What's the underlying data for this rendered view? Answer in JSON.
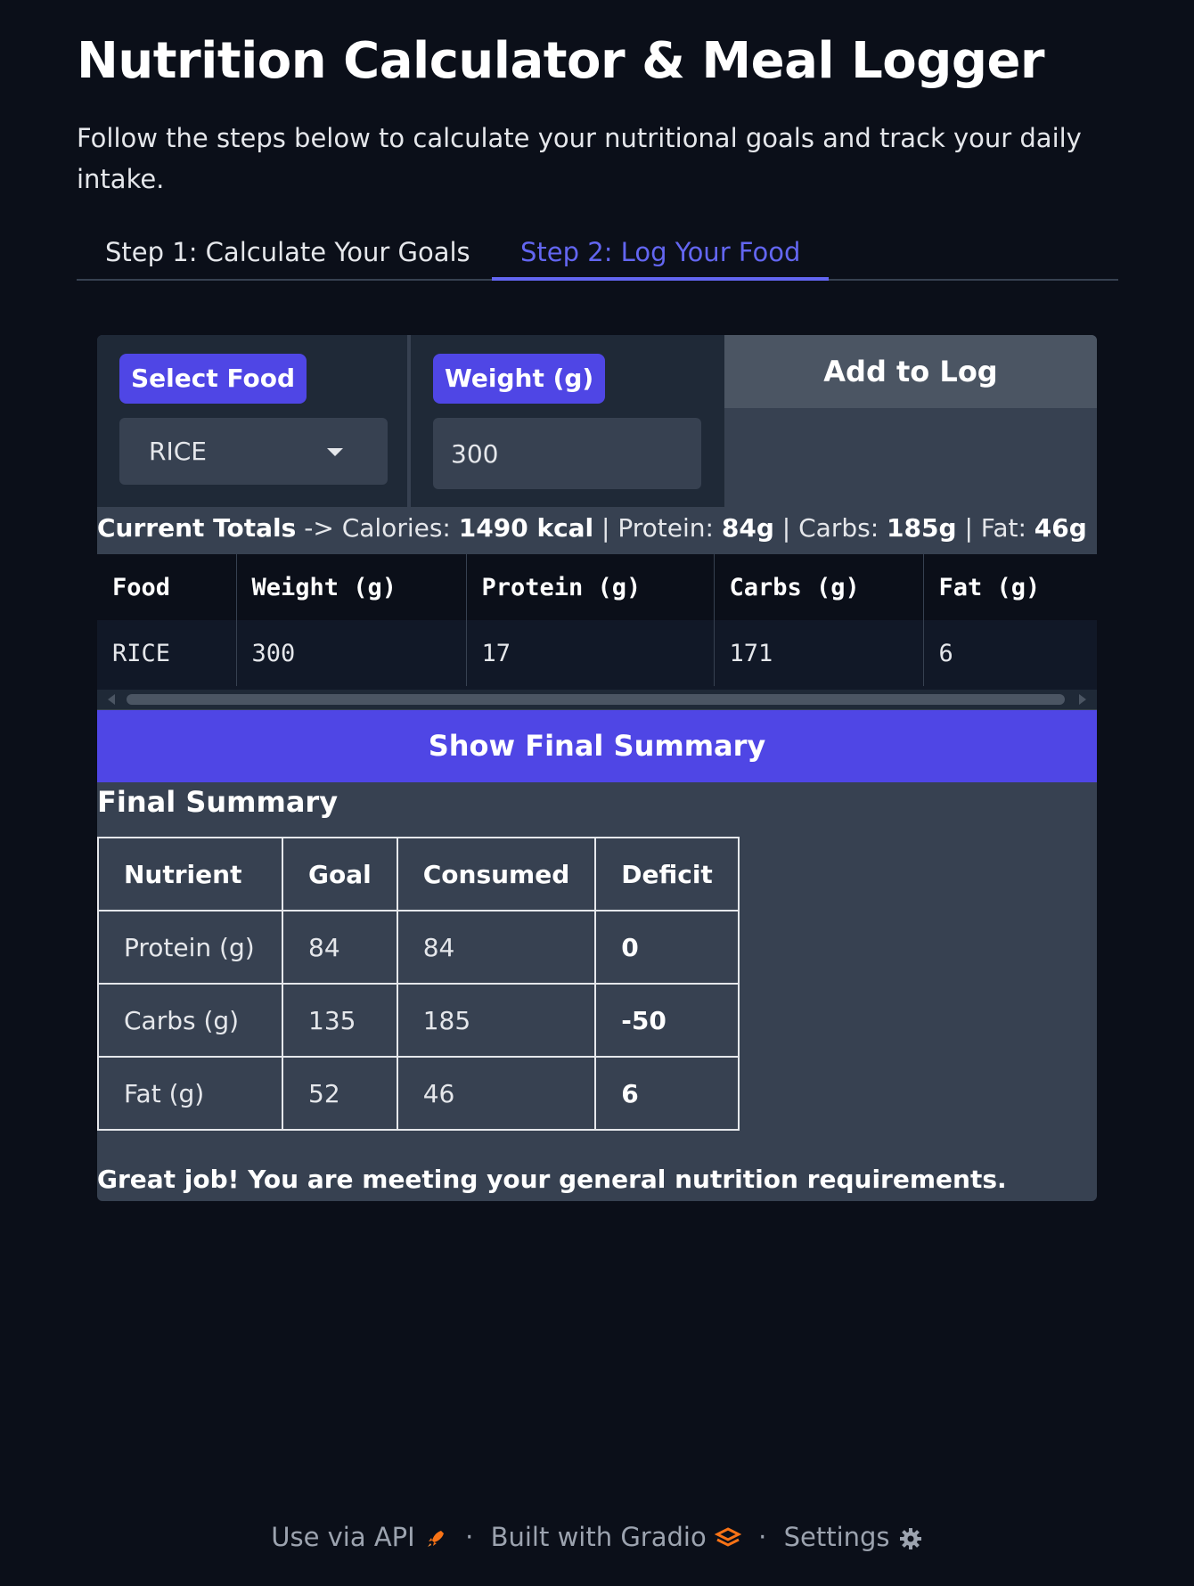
{
  "header": {
    "title": "Nutrition Calculator & Meal Logger",
    "subtitle": "Follow the steps below to calculate your nutritional goals and track your daily intake."
  },
  "tabs": [
    {
      "label": "Step 1: Calculate Your Goals",
      "active": false
    },
    {
      "label": "Step 2: Log Your Food",
      "active": true
    }
  ],
  "form": {
    "food_label": "Select Food",
    "food_value": "RICE",
    "weight_label": "Weight (g)",
    "weight_value": "300",
    "add_button": "Add to Log"
  },
  "totals": {
    "prefix": "Current Totals",
    "arrow": " -> Calories: ",
    "calories": "1490 kcal",
    "protein_label": " | Protein: ",
    "protein": "84g",
    "carbs_label": " | Carbs: ",
    "carbs": "185g",
    "fat_label": " | Fat: ",
    "fat": "46g"
  },
  "log_table": {
    "headers": [
      "Food",
      "Weight (g)",
      "Protein (g)",
      "Carbs (g)",
      "Fat (g)"
    ],
    "rows": [
      [
        "RICE",
        "300",
        "17",
        "171",
        "6"
      ]
    ]
  },
  "summary_button": "Show Final Summary",
  "final_summary": {
    "heading": "Final Summary",
    "headers": [
      "Nutrient",
      "Goal",
      "Consumed",
      "Deficit"
    ],
    "rows": [
      [
        "Protein (g)",
        "84",
        "84",
        "0"
      ],
      [
        "Carbs (g)",
        "135",
        "185",
        "-50"
      ],
      [
        "Fat (g)",
        "52",
        "46",
        "6"
      ]
    ],
    "message": "Great job! You are meeting your general nutrition requirements."
  },
  "footer": {
    "api": "Use via API",
    "built": "Built with Gradio",
    "settings": "Settings",
    "separator": "·",
    "icons": [
      "rocket-icon",
      "gradio-logo-icon",
      "gear-icon"
    ],
    "accent_orange": "#f97316"
  },
  "colors": {
    "background": "#0b0f19",
    "panel": "#374151",
    "accent": "#4f46e5",
    "tab_active": "#6366f1"
  }
}
